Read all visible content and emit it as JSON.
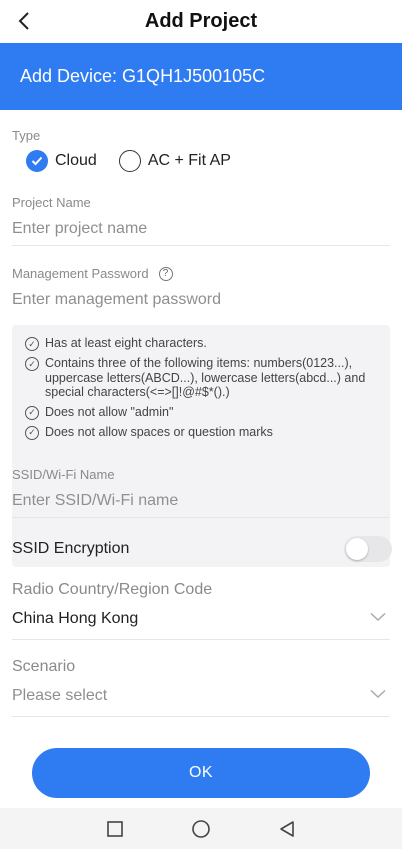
{
  "header": {
    "title": "Add Project"
  },
  "banner": {
    "text": "Add Device: G1QH1J500105C"
  },
  "type": {
    "label": "Type",
    "options": [
      {
        "label": "Cloud",
        "selected": true
      },
      {
        "label": "AC + Fit AP",
        "selected": false
      }
    ]
  },
  "project_name": {
    "label": "Project Name",
    "placeholder": "Enter project name"
  },
  "management_password": {
    "label": "Management Password",
    "placeholder": "Enter management password",
    "rules": [
      "Has at least eight characters.",
      "Contains three of the following items: numbers(0123...), uppercase letters(ABCD...), lowercase letters(abcd...) and special characters(<=>[]!@#$*().)",
      "Does not allow \"admin\"",
      "Does not allow spaces or question marks"
    ]
  },
  "ssid": {
    "label": "SSID/Wi-Fi Name",
    "placeholder": "Enter SSID/Wi-Fi name"
  },
  "ssid_encryption": {
    "label": "SSID Encryption",
    "enabled": false
  },
  "radio_country": {
    "label": "Radio Country/Region Code",
    "value": "China Hong Kong"
  },
  "scenario": {
    "label": "Scenario",
    "value": "Please select"
  },
  "ok_button": {
    "label": "OK"
  },
  "colors": {
    "accent": "#2f7bf1",
    "muted_text": "#8a8a8a",
    "rules_bg": "#f3f3f5"
  }
}
